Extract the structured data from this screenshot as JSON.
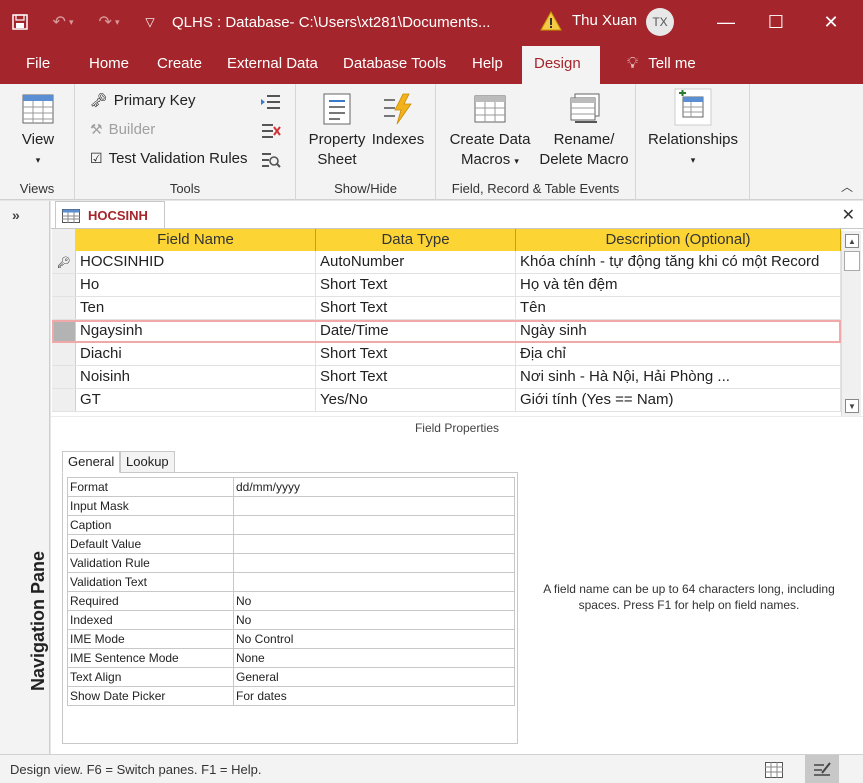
{
  "titlebar": {
    "title": "QLHS : Database- C:\\Users\\xt281\\Documents...",
    "user": "Thu Xuan",
    "initials": "TX",
    "minimize": "—",
    "maximize": "☐",
    "close": "✕",
    "accent": "#a4262c"
  },
  "ribbon_tabs": [
    "File",
    "Home",
    "Create",
    "External Data",
    "Database Tools",
    "Help",
    "Design",
    "Tell me"
  ],
  "ribbon": {
    "view": {
      "label": "View",
      "group": "Views"
    },
    "tools": {
      "primary_key": "Primary Key",
      "builder": "Builder",
      "test_validation": "Test Validation Rules",
      "group": "Tools"
    },
    "showhide": {
      "property_line1": "Property",
      "property_line2": "Sheet",
      "indexes": "Indexes",
      "group": "Show/Hide"
    },
    "events": {
      "create_line1": "Create Data",
      "create_line2": "Macros",
      "rename_line1": "Rename/",
      "rename_line2": "Delete Macro",
      "group": "Field, Record & Table Events"
    },
    "relationships": {
      "label": "Relationships"
    }
  },
  "navigation": {
    "label": "Navigation Pane",
    "toggle": "»"
  },
  "document": {
    "tab_label": "HOCSINH",
    "close": "✕"
  },
  "grid": {
    "headers": [
      "Field Name",
      "Data Type",
      "Description (Optional)"
    ],
    "rows": [
      {
        "name": "HOCSINHID",
        "type": "AutoNumber",
        "desc": "Khóa chính - tự động tăng khi có một Record"
      },
      {
        "name": "Ho",
        "type": "Short Text",
        "desc": "Họ và tên đệm"
      },
      {
        "name": "Ten",
        "type": "Short Text",
        "desc": "Tên"
      },
      {
        "name": "Ngaysinh",
        "type": "Date/Time",
        "desc": "Ngày sinh"
      },
      {
        "name": "Diachi",
        "type": "Short Text",
        "desc": "Địa chỉ"
      },
      {
        "name": "Noisinh",
        "type": "Short Text",
        "desc": "Nơi sinh - Hà Nội, Hải Phòng ..."
      },
      {
        "name": "GT",
        "type": "Yes/No",
        "desc": "Giới tính (Yes == Nam)"
      }
    ]
  },
  "field_properties": {
    "title": "Field Properties",
    "tabs": [
      "General",
      "Lookup"
    ],
    "rows": [
      {
        "k": "Format",
        "v": "dd/mm/yyyy"
      },
      {
        "k": "Input Mask",
        "v": ""
      },
      {
        "k": "Caption",
        "v": ""
      },
      {
        "k": "Default Value",
        "v": ""
      },
      {
        "k": "Validation Rule",
        "v": ""
      },
      {
        "k": "Validation Text",
        "v": ""
      },
      {
        "k": "Required",
        "v": "No"
      },
      {
        "k": "Indexed",
        "v": "No"
      },
      {
        "k": "IME Mode",
        "v": "No Control"
      },
      {
        "k": "IME Sentence Mode",
        "v": "None"
      },
      {
        "k": "Text Align",
        "v": "General"
      },
      {
        "k": "Show Date Picker",
        "v": "For dates"
      }
    ],
    "hint": "A field name can be up to 64 characters long, including spaces. Press F1 for help on field names."
  },
  "statusbar": {
    "text": "Design view.  F6 = Switch panes.  F1 = Help."
  }
}
